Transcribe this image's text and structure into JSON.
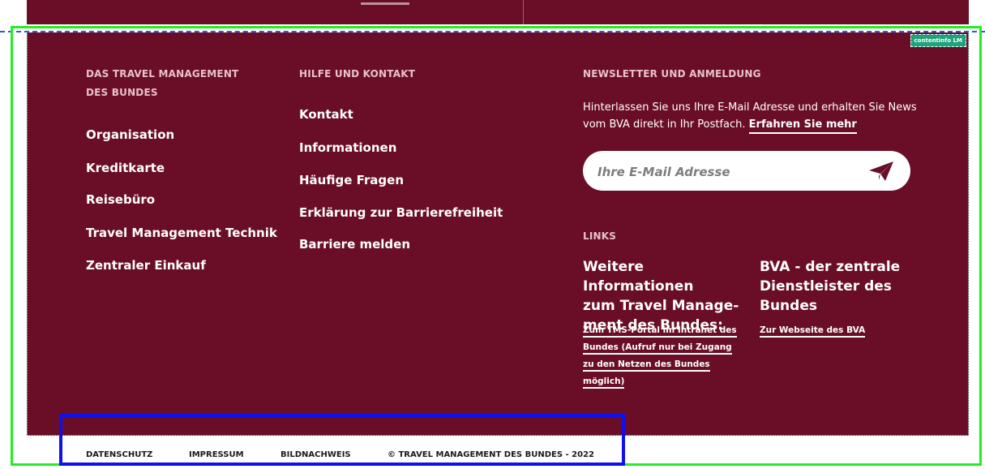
{
  "footer": {
    "badge": "contentinfo LM",
    "col1": {
      "heading": "DAS TRAVEL MANAGEMENT DES BUNDES",
      "links": [
        "Organisation",
        "Kreditkarte",
        "Reisebüro",
        "Travel Management Technik",
        "Zentraler Einkauf"
      ]
    },
    "col2": {
      "heading": "HILFE UND KONTAKT",
      "links": [
        "Kontakt",
        "Informationen",
        "Häufige Fragen",
        "Erklärung zur Barrierefreiheit",
        "Barriere melden"
      ]
    },
    "newsletter": {
      "heading": "NEWSLETTER UND ANMELDUNG",
      "text": "Hinterlassen Sie uns Ihre E-Mail Adresse und erhalten Sie News vom BVA direkt in Ihr Postfach.",
      "more_label": "Erfahren Sie mehr",
      "email_placeholder": "Ihre E-Mail Adresse",
      "send_icon": "paper-plane-icon"
    },
    "links": {
      "heading": "LINKS",
      "group1": {
        "title_lines": [
          "Weitere Informationen",
          "zum Travel Manage-",
          "ment des Bundes:"
        ],
        "link_lines": [
          "Zum TMS-Portal im Intranet des",
          "Bundes (Aufruf nur bei Zugang",
          "zu den Netzen des Bundes",
          "möglich)"
        ]
      },
      "group2": {
        "title_lines": [
          "BVA - der zentrale",
          "Dienstleister des",
          "Bundes"
        ],
        "link_lines": [
          "Zur Webseite des BVA"
        ]
      }
    }
  },
  "bottom_bar": {
    "datenschutz": "DATENSCHUTZ",
    "impressum": "IMPRESSUM",
    "bildnachweis": "BILDNACHWEIS",
    "copyright": "© TRAVEL MANAGEMENT DES BUNDES - 2022"
  },
  "colors": {
    "footer_bg": "#690e26",
    "heading": "#e7c2c9",
    "outline_green": "#22ee22",
    "outline_blue": "#1010ee"
  }
}
